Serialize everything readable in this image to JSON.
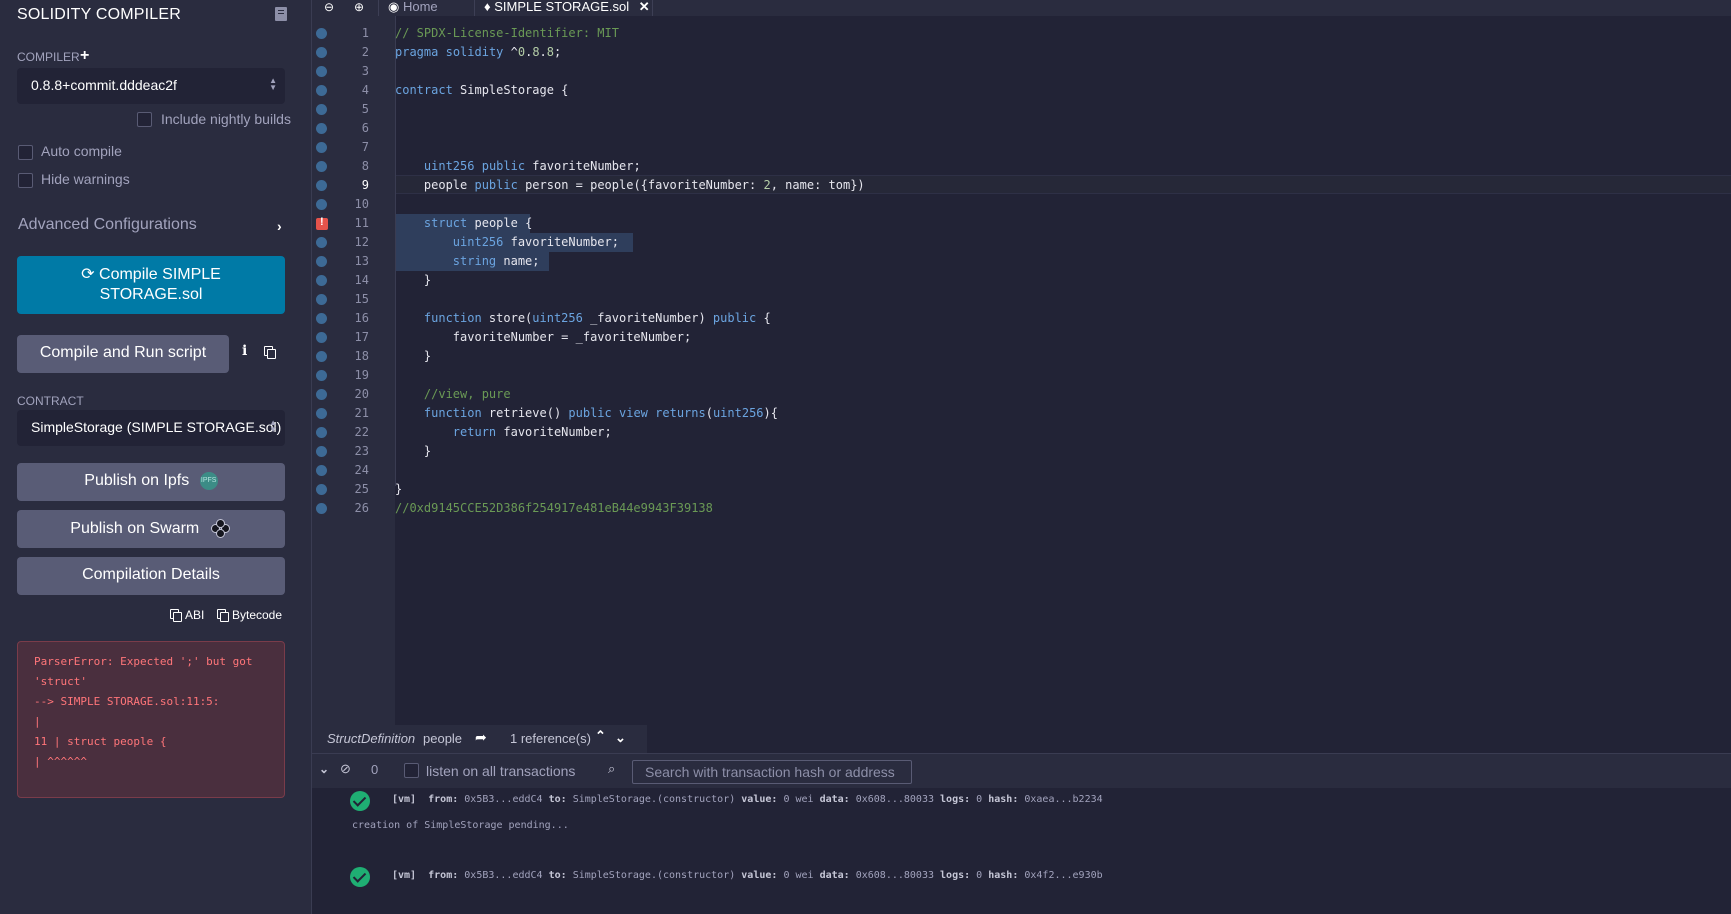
{
  "sidebar": {
    "title": "SOLIDITY COMPILER",
    "compiler_label": "COMPILER",
    "compiler_version": "0.8.8+commit.dddeac2f",
    "nightly_label": "Include nightly builds",
    "auto_compile_label": "Auto compile",
    "hide_warnings_label": "Hide warnings",
    "advanced_label": "Advanced Configurations",
    "compile_button_line1": "Compile SIMPLE",
    "compile_button_line2": "STORAGE.sol",
    "run_script_label": "Compile and Run script",
    "contract_label": "CONTRACT",
    "contract_value": "SimpleStorage (SIMPLE STORAGE.sol)",
    "ipfs_label": "Publish on Ipfs",
    "ipfs_badge": "IPFS",
    "swarm_label": "Publish on Swarm",
    "details_label": "Compilation Details",
    "abi_label": "ABI",
    "bytecode_label": "Bytecode",
    "error_lines": [
      "ParserError: Expected ';' but got",
      "'struct'",
      "--> SIMPLE STORAGE.sol:11:5:",
      "|",
      "11 | struct people {",
      "| ^^^^^^"
    ]
  },
  "tabs": {
    "home_label": "Home",
    "file_label": "SIMPLE STORAGE.sol"
  },
  "editor": {
    "current_line": 9,
    "error_line": 11,
    "lines": [
      "// SPDX-License-Identifier: MIT",
      "pragma solidity ^0.8.8;",
      "",
      "contract SimpleStorage {",
      "",
      "",
      "",
      "    uint256 public favoriteNumber;",
      "    people public person = people({favoriteNumber: 2, name: tom})",
      "",
      "    struct people {",
      "        uint256 favoriteNumber;",
      "        string name;",
      "    }",
      "",
      "    function store(uint256 _favoriteNumber) public {",
      "        favoriteNumber = _favoriteNumber;",
      "    }",
      "",
      "    //view, pure",
      "    function retrieve() public view returns(uint256){",
      "        return favoriteNumber;",
      "    }",
      "",
      "}",
      "//0xd9145CCE52D386f254917e481eB44e9943F39138"
    ]
  },
  "reference_bar": {
    "kind": "StructDefinition",
    "name": "people",
    "references": "1 reference(s)"
  },
  "terminal": {
    "pending_count": "0",
    "listen_label": "listen on all transactions",
    "search_placeholder": "Search with transaction hash or address",
    "logs": [
      {
        "tag": "[vm]",
        "from": "0x5B3...eddC4",
        "to": "SimpleStorage.(constructor)",
        "value": "0 wei",
        "data": "0x608...80033",
        "logs": "0",
        "hash": "0xaea...b2234"
      },
      {
        "message": "creation of SimpleStorage pending..."
      },
      {
        "tag": "[vm]",
        "from": "0x5B3...eddC4",
        "to": "SimpleStorage.(constructor)",
        "value": "0 wei",
        "data": "0x608...80033",
        "logs": "0",
        "hash": "0x4f2...e930b"
      }
    ]
  },
  "colors": {
    "accent": "#007aa6",
    "error": "#ff7579",
    "success": "#1fae73",
    "keyword": "#6ba4e0",
    "comment": "#6a9955"
  }
}
